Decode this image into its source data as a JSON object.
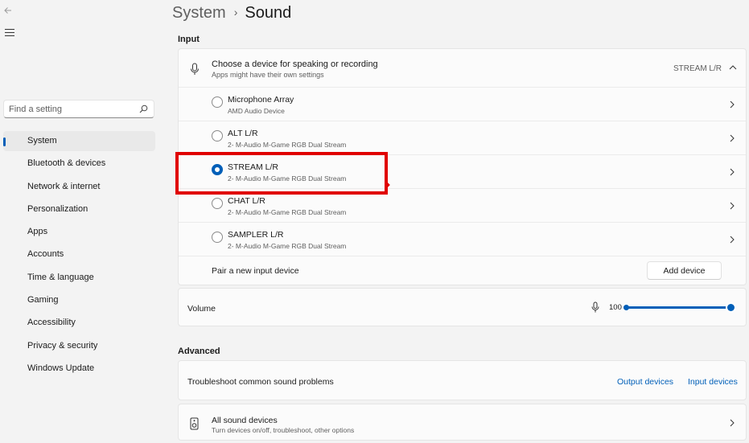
{
  "breadcrumb": {
    "parent": "System",
    "separator": "›",
    "current": "Sound"
  },
  "search": {
    "placeholder": "Find a setting"
  },
  "sidebar": {
    "items": [
      {
        "label": "System",
        "active": true
      },
      {
        "label": "Bluetooth & devices"
      },
      {
        "label": "Network & internet"
      },
      {
        "label": "Personalization"
      },
      {
        "label": "Apps"
      },
      {
        "label": "Accounts"
      },
      {
        "label": "Time & language"
      },
      {
        "label": "Gaming"
      },
      {
        "label": "Accessibility"
      },
      {
        "label": "Privacy & security"
      },
      {
        "label": "Windows Update"
      }
    ]
  },
  "input": {
    "section_label": "Input",
    "header_title": "Choose a device for speaking or recording",
    "header_subtitle": "Apps might have their own settings",
    "selected_device": "STREAM L/R",
    "devices": [
      {
        "name": "Microphone Array",
        "desc": "AMD Audio Device",
        "selected": false
      },
      {
        "name": "ALT L/R",
        "desc": "2- M-Audio M-Game RGB Dual Stream",
        "selected": false
      },
      {
        "name": "STREAM L/R",
        "desc": "2- M-Audio M-Game RGB Dual Stream",
        "selected": true
      },
      {
        "name": "CHAT L/R",
        "desc": "2- M-Audio M-Game RGB Dual Stream",
        "selected": false
      },
      {
        "name": "SAMPLER L/R",
        "desc": "2- M-Audio M-Game RGB Dual Stream",
        "selected": false
      }
    ],
    "pair_label": "Pair a new input device",
    "add_device_button": "Add device"
  },
  "volume": {
    "label": "Volume",
    "value": "100",
    "level_percent": 100
  },
  "advanced": {
    "section_label": "Advanced",
    "troubleshoot_label": "Troubleshoot common sound problems",
    "output_devices_link": "Output devices",
    "input_devices_link": "Input devices",
    "all_devices_title": "All sound devices",
    "all_devices_subtitle": "Turn devices on/off, troubleshoot, other options"
  },
  "colors": {
    "accent": "#005fb8",
    "highlight_box": "#e00000",
    "background": "#f3f3f3"
  }
}
